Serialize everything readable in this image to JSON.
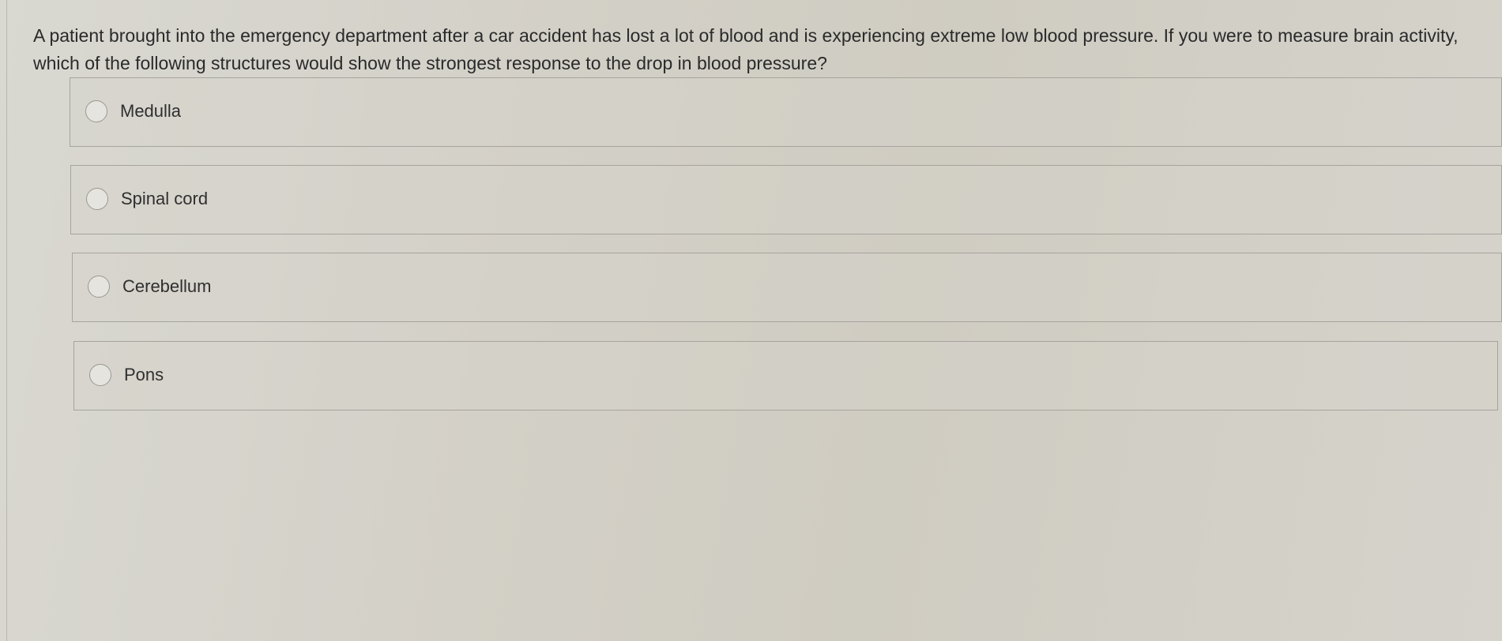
{
  "question": {
    "text": "A patient brought into the emergency department after a car accident has lost a lot of blood and is experiencing extreme low blood pressure. If you were to measure brain activity, which of the following structures would show the strongest response to the drop in blood pressure?"
  },
  "options": [
    {
      "label": "Medulla",
      "selected": false
    },
    {
      "label": "Spinal cord",
      "selected": false
    },
    {
      "label": "Cerebellum",
      "selected": false
    },
    {
      "label": "Pons",
      "selected": false
    }
  ],
  "colors": {
    "border": "#a6a49d",
    "radio_border": "#9a9892",
    "text": "#2b2b2b"
  }
}
